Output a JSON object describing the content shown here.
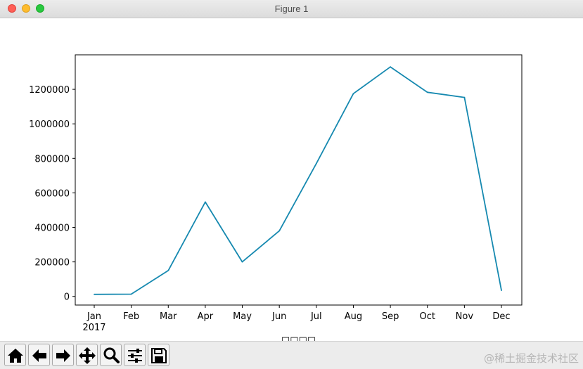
{
  "window": {
    "title": "Figure 1"
  },
  "chart_data": {
    "type": "line",
    "categories": [
      "Jan\n2017",
      "Feb",
      "Mar",
      "Apr",
      "May",
      "Jun",
      "Jul",
      "Aug",
      "Sep",
      "Oct",
      "Nov",
      "Dec"
    ],
    "series": [
      {
        "values": [
          12000,
          13000,
          150000,
          547000,
          200000,
          380000,
          770000,
          1175000,
          1330000,
          1183000,
          1153000,
          35000
        ]
      }
    ],
    "ylim": [
      -50000,
      1400000
    ],
    "yticks": [
      0,
      200000,
      400000,
      600000,
      800000,
      1000000,
      1200000
    ],
    "xlabel": "□□□□",
    "ylabel": "",
    "line_color": "#1689b0"
  },
  "toolbar": {
    "buttons": [
      {
        "icon": "home-icon"
      },
      {
        "icon": "arrow-left-icon"
      },
      {
        "icon": "arrow-right-icon"
      },
      {
        "icon": "move-icon"
      },
      {
        "icon": "zoom-icon"
      },
      {
        "icon": "sliders-icon"
      },
      {
        "icon": "save-icon"
      }
    ]
  },
  "watermark": "@稀土掘金技术社区"
}
